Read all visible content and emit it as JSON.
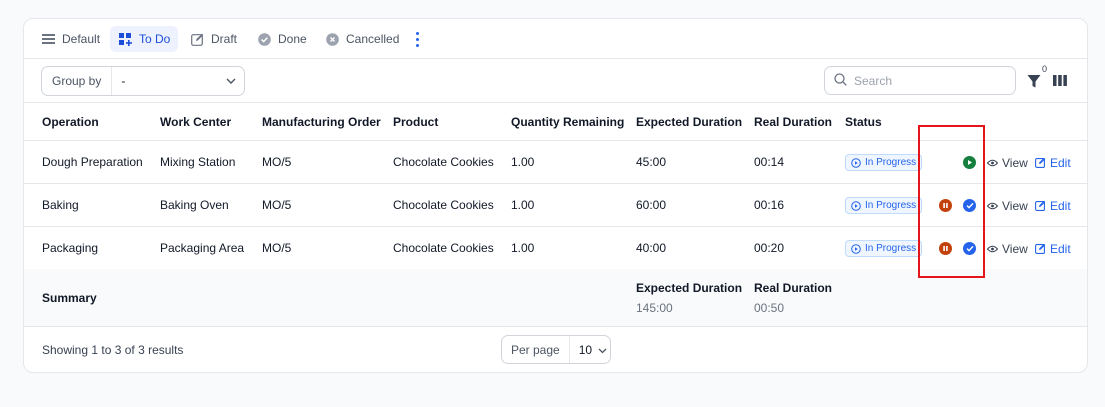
{
  "tabs": [
    {
      "label": "Default",
      "icon": "list-icon"
    },
    {
      "label": "To Do",
      "icon": "todo-icon"
    },
    {
      "label": "Draft",
      "icon": "edit-icon"
    },
    {
      "label": "Done",
      "icon": "check-circle-icon"
    },
    {
      "label": "Cancelled",
      "icon": "x-circle-icon"
    }
  ],
  "active_tab": "To Do",
  "toolbar": {
    "group_by_label": "Group by",
    "group_by_value": "-",
    "search_placeholder": "Search",
    "filter_count": "0"
  },
  "table": {
    "columns": [
      "Operation",
      "Work Center",
      "Manufacturing Order",
      "Product",
      "Quantity Remaining",
      "Expected Duration",
      "Real Duration",
      "Status"
    ],
    "rows": [
      {
        "operation": "Dough Preparation",
        "work_center": "Mixing Station",
        "mo": "MO/5",
        "product": "Chocolate Cookies",
        "qty": "1.00",
        "expected": "45:00",
        "real": "00:14",
        "status": "In Progress",
        "actions": [
          "play"
        ]
      },
      {
        "operation": "Baking",
        "work_center": "Baking Oven",
        "mo": "MO/5",
        "product": "Chocolate Cookies",
        "qty": "1.00",
        "expected": "60:00",
        "real": "00:16",
        "status": "In Progress",
        "actions": [
          "pause",
          "done"
        ]
      },
      {
        "operation": "Packaging",
        "work_center": "Packaging Area",
        "mo": "MO/5",
        "product": "Chocolate Cookies",
        "qty": "1.00",
        "expected": "40:00",
        "real": "00:20",
        "status": "In Progress",
        "actions": [
          "pause",
          "done"
        ]
      }
    ],
    "view_label": "View",
    "edit_label": "Edit"
  },
  "summary": {
    "title": "Summary",
    "expected_label": "Expected Duration",
    "expected_value": "145:00",
    "real_label": "Real Duration",
    "real_value": "00:50"
  },
  "footer": {
    "showing": "Showing 1 to 3 of 3 results",
    "per_page_label": "Per page",
    "per_page_value": "10"
  },
  "colors": {
    "accent": "#2563eb",
    "play": "#15803d",
    "pause": "#c2410c",
    "highlight": "#e5141b"
  }
}
